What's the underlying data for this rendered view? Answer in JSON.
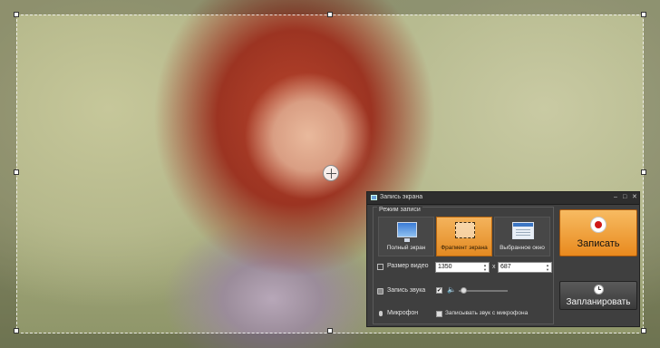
{
  "window": {
    "title": "Запись экрана",
    "controls": {
      "minimize": "–",
      "maximize": "□",
      "close": "✕"
    }
  },
  "record_mode": {
    "group_label": "Режим записи",
    "options": [
      {
        "label": "Полный экран",
        "icon": "monitor-icon",
        "selected": false
      },
      {
        "label": "Фрагмент экрана",
        "icon": "screen-fragment-icon",
        "selected": true
      },
      {
        "label": "Выбранное окно",
        "icon": "window-icon",
        "selected": false
      }
    ]
  },
  "video_size": {
    "label": "Размер видео",
    "width": "1350",
    "height": "687",
    "separator": "x"
  },
  "sound": {
    "label": "Запись звука",
    "checked": true,
    "volume": 0.1
  },
  "microphone": {
    "label": "Микрофон",
    "checkbox_label": "Записывать звук с микрофона",
    "checked": false
  },
  "buttons": {
    "record": "Записать",
    "schedule": "Запланировать"
  },
  "colors": {
    "accent": "#e98a1e",
    "record_dot": "#d01818",
    "dialog_bg": "#3f3f3f"
  }
}
